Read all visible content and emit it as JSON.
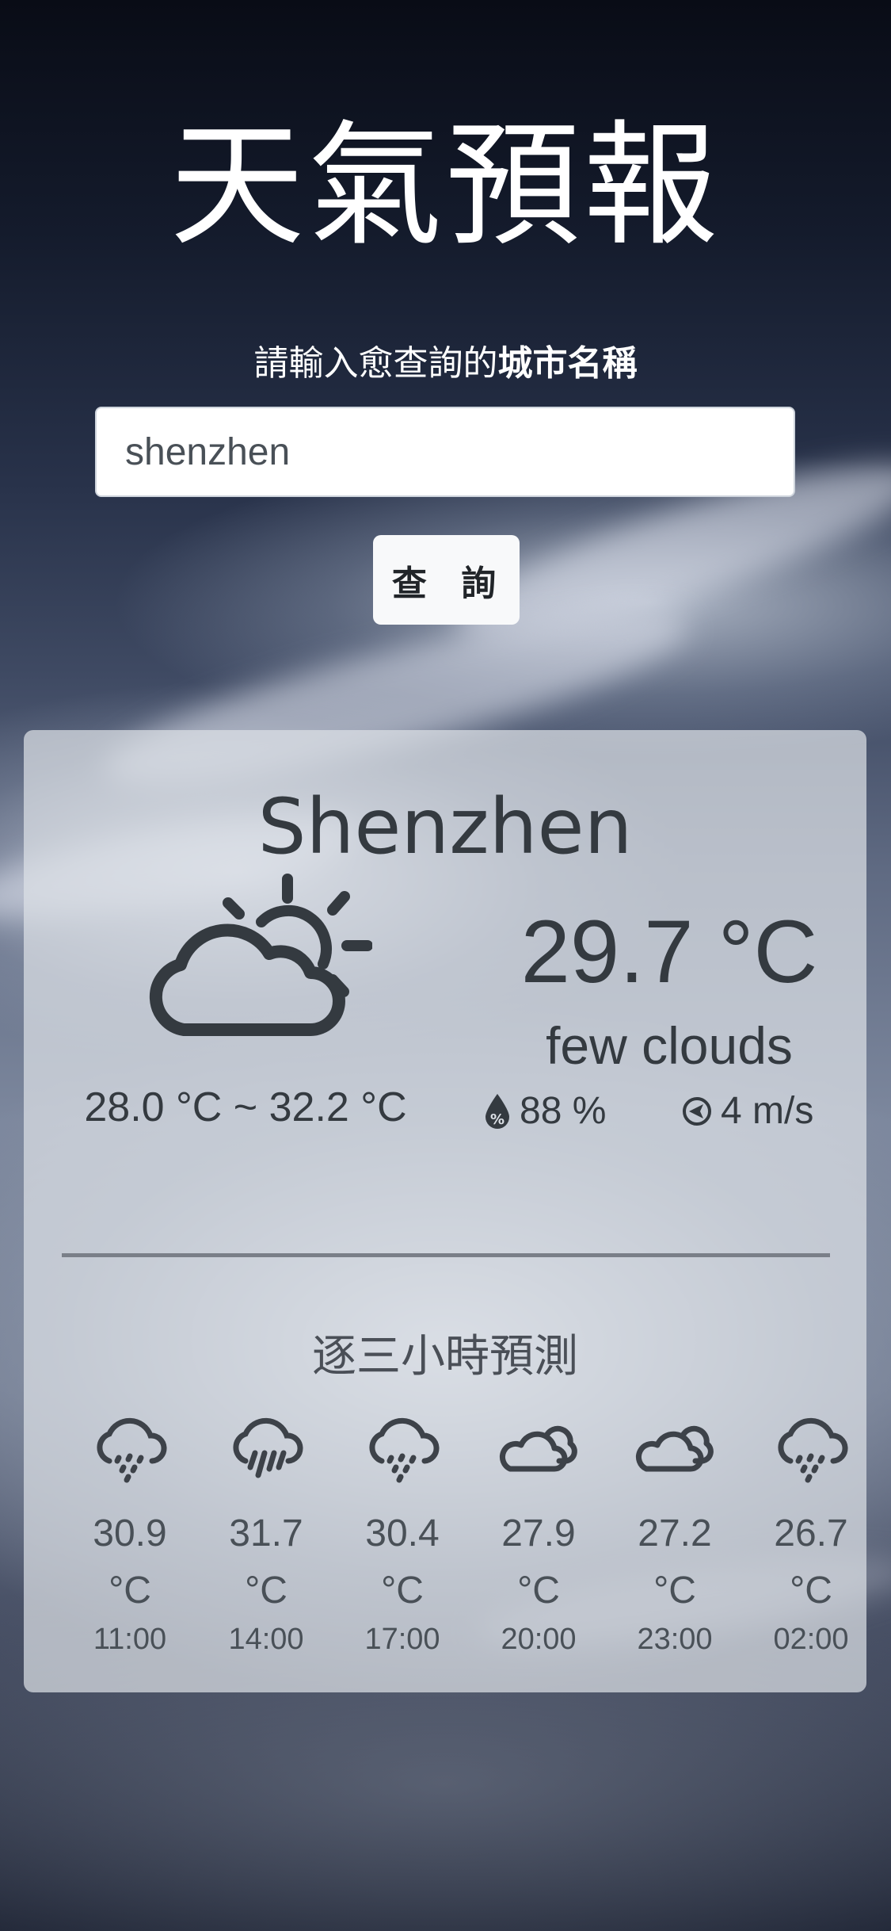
{
  "app": {
    "title": "天氣預報",
    "prompt_prefix": "請輸入愈查詢的",
    "prompt_bold": "城市名稱"
  },
  "search": {
    "value": "shenzhen",
    "placeholder": "",
    "button_label": "查 詢"
  },
  "current": {
    "city": "Shenzhen",
    "temperature": "29.7 °C",
    "description": "few clouds",
    "range": "28.0 °C ~ 32.2 °C",
    "humidity": "88 %",
    "wind": "4 m/s",
    "icon": "partly-cloudy-day-icon"
  },
  "forecast": {
    "title": "逐三小時預測",
    "items": [
      {
        "icon": "rain-icon",
        "temp": "30.9",
        "unit": "°C",
        "time": "11:00"
      },
      {
        "icon": "heavy-rain-icon",
        "temp": "31.7",
        "unit": "°C",
        "time": "14:00"
      },
      {
        "icon": "rain-icon",
        "temp": "30.4",
        "unit": "°C",
        "time": "17:00"
      },
      {
        "icon": "cloudy-icon",
        "temp": "27.9",
        "unit": "°C",
        "time": "20:00"
      },
      {
        "icon": "cloudy-icon",
        "temp": "27.2",
        "unit": "°C",
        "time": "23:00"
      },
      {
        "icon": "rain-icon",
        "temp": "26.7",
        "unit": "°C",
        "time": "02:00"
      }
    ]
  },
  "colors": {
    "text_dark": "#343a40",
    "card_bg": "#dce0e6",
    "button_bg": "#f8f9fa"
  }
}
